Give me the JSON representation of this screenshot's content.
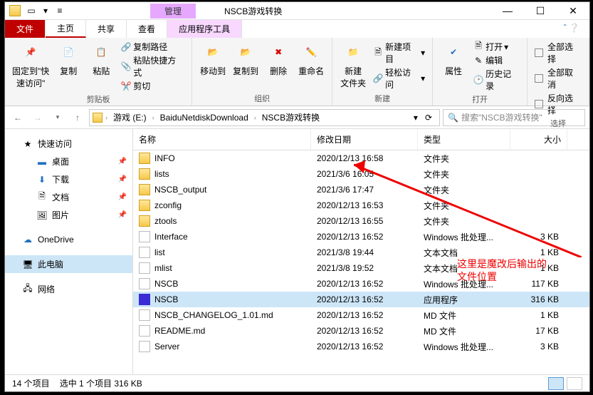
{
  "titlebar": {
    "contextual": "管理",
    "title": "NSCB游戏转换"
  },
  "tabs": {
    "file": "文件",
    "home": "主页",
    "share": "共享",
    "view": "查看",
    "apptools": "应用程序工具"
  },
  "ribbon": {
    "pin": "固定到\"快\n速访问\"",
    "copy": "复制",
    "paste": "粘贴",
    "copy_path": "复制路径",
    "paste_shortcut": "粘贴快捷方式",
    "cut": "剪切",
    "clipboard": "剪贴板",
    "moveto": "移动到",
    "copyto": "复制到",
    "delete": "删除",
    "rename": "重命名",
    "organize": "组织",
    "newfolder": "新建\n文件夹",
    "newitem": "新建项目",
    "easyaccess": "轻松访问",
    "new": "新建",
    "properties": "属性",
    "open": "打开",
    "edit": "编辑",
    "history": "历史记录",
    "open_group": "打开",
    "selectall": "全部选择",
    "selectnone": "全部取消",
    "invert": "反向选择",
    "select": "选择"
  },
  "breadcrumb": [
    "游戏 (E:)",
    "BaiduNetdiskDownload",
    "NSCB游戏转换"
  ],
  "search_placeholder": "搜索\"NSCB游戏转换\"",
  "sidebar": {
    "quick": "快速访问",
    "desktop": "桌面",
    "downloads": "下载",
    "documents": "文档",
    "pictures": "图片",
    "onedrive": "OneDrive",
    "thispc": "此电脑",
    "network": "网络"
  },
  "columns": {
    "name": "名称",
    "date": "修改日期",
    "type": "类型",
    "size": "大小"
  },
  "rows": [
    {
      "icon": "folder",
      "name": "INFO",
      "date": "2020/12/13 16:58",
      "type": "文件夹",
      "size": "",
      "sel": false
    },
    {
      "icon": "folder",
      "name": "lists",
      "date": "2021/3/6 16:05",
      "type": "文件夹",
      "size": "",
      "sel": false
    },
    {
      "icon": "folder",
      "name": "NSCB_output",
      "date": "2021/3/6 17:47",
      "type": "文件夹",
      "size": "",
      "sel": false
    },
    {
      "icon": "folder",
      "name": "zconfig",
      "date": "2020/12/13 16:53",
      "type": "文件夹",
      "size": "",
      "sel": false
    },
    {
      "icon": "folder",
      "name": "ztools",
      "date": "2020/12/13 16:55",
      "type": "文件夹",
      "size": "",
      "sel": false
    },
    {
      "icon": "file",
      "name": "Interface",
      "date": "2020/12/13 16:52",
      "type": "Windows 批处理...",
      "size": "3 KB",
      "sel": false
    },
    {
      "icon": "file",
      "name": "list",
      "date": "2021/3/8 19:44",
      "type": "文本文档",
      "size": "1 KB",
      "sel": false
    },
    {
      "icon": "file",
      "name": "mlist",
      "date": "2021/3/8 19:52",
      "type": "文本文档",
      "size": "1 KB",
      "sel": false
    },
    {
      "icon": "file",
      "name": "NSCB",
      "date": "2020/12/13 16:52",
      "type": "Windows 批处理...",
      "size": "117 KB",
      "sel": false
    },
    {
      "icon": "exe",
      "name": "NSCB",
      "date": "2020/12/13 16:52",
      "type": "应用程序",
      "size": "316 KB",
      "sel": true
    },
    {
      "icon": "file",
      "name": "NSCB_CHANGELOG_1.01.md",
      "date": "2020/12/13 16:52",
      "type": "MD 文件",
      "size": "1 KB",
      "sel": false
    },
    {
      "icon": "file",
      "name": "README.md",
      "date": "2020/12/13 16:52",
      "type": "MD 文件",
      "size": "17 KB",
      "sel": false
    },
    {
      "icon": "file",
      "name": "Server",
      "date": "2020/12/13 16:52",
      "type": "Windows 批处理...",
      "size": "3 KB",
      "sel": false
    }
  ],
  "annotation": "这里是魔改后输出的\n文件位置",
  "status": {
    "count": "14 个项目",
    "selection": "选中 1 个项目  316 KB"
  }
}
